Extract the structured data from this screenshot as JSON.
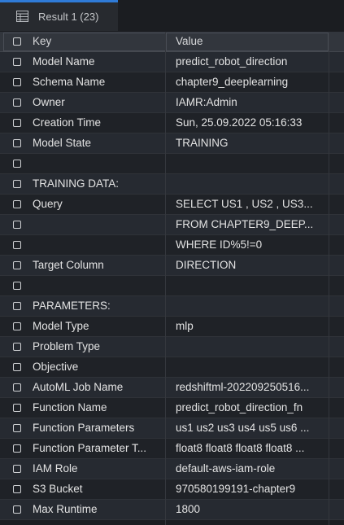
{
  "tab": {
    "label": "Result 1 (23)"
  },
  "columns": {
    "key": "Key",
    "value": "Value"
  },
  "rows": [
    {
      "key": "Model Name",
      "value": "predict_robot_direction"
    },
    {
      "key": "Schema Name",
      "value": "chapter9_deeplearning"
    },
    {
      "key": "Owner",
      "value": "IAMR:Admin"
    },
    {
      "key": "Creation Time",
      "value": "Sun, 25.09.2022 05:16:33"
    },
    {
      "key": "Model State",
      "value": "TRAINING"
    },
    {
      "key": "",
      "value": ""
    },
    {
      "key": "TRAINING DATA:",
      "value": ""
    },
    {
      "key": "Query",
      "value": "SELECT US1 , US2 , US3..."
    },
    {
      "key": "",
      "value": "FROM CHAPTER9_DEEP..."
    },
    {
      "key": "",
      "value": "WHERE ID%5!=0"
    },
    {
      "key": "Target Column",
      "value": "DIRECTION"
    },
    {
      "key": "",
      "value": ""
    },
    {
      "key": "PARAMETERS:",
      "value": ""
    },
    {
      "key": "Model Type",
      "value": "mlp"
    },
    {
      "key": "Problem Type",
      "value": ""
    },
    {
      "key": "Objective",
      "value": ""
    },
    {
      "key": "AutoML Job Name",
      "value": "redshiftml-20220925​0516..."
    },
    {
      "key": "Function Name",
      "value": "predict_robot_direction_fn"
    },
    {
      "key": "Function Parameters",
      "value": "us1 us2 us3 us4 us5 us6 ..."
    },
    {
      "key": "Function Parameter T...",
      "value": "float8 float8 float8 float8 ..."
    },
    {
      "key": "IAM Role",
      "value": "default-aws-iam-role"
    },
    {
      "key": "S3 Bucket",
      "value": "970580199191-chapter9"
    },
    {
      "key": "Max Runtime",
      "value": "1800"
    }
  ]
}
